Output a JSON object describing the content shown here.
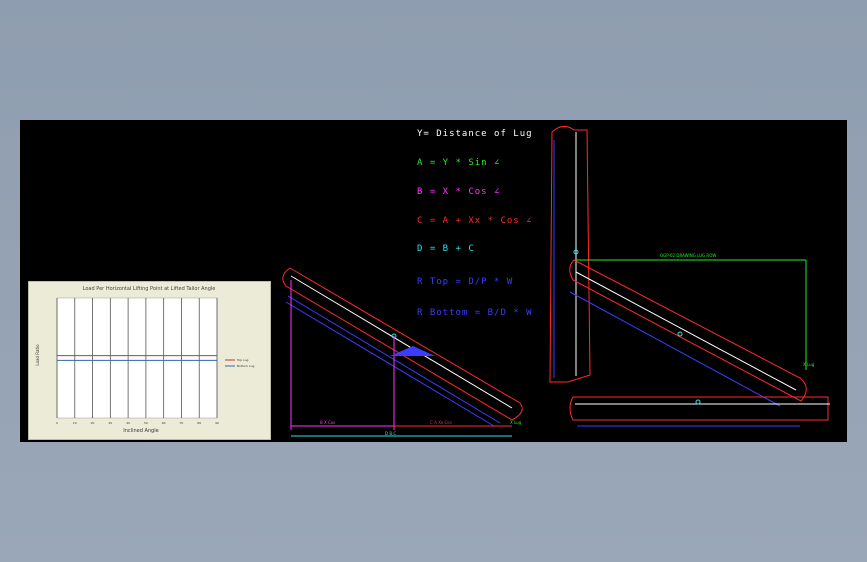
{
  "formulas": {
    "y_def": "Y= Distance of Lug",
    "a": "A = Y * Sin ∠",
    "b": "B = X * Cos ∠",
    "c": "C = A + Xx * Cos ∠",
    "d": "D = B + C",
    "r_top": "R Top = D/P * W",
    "r_bottom": "R Bottom = B/D * W"
  },
  "colors": {
    "white": "#ffffff",
    "green": "#22ee22",
    "magenta": "#ff33ff",
    "red": "#ff2a2a",
    "cyan": "#33e0e0",
    "blue": "#3c3cff",
    "panel": "#ecebd8"
  },
  "dimensions": {
    "left_b": "B X Cos",
    "left_c": "C A Xx Cos",
    "left_d": "D B C",
    "left_lug": "X Lug",
    "right_top": "OGP-02 DRAWING LUG ROW",
    "right_small": "X Lug"
  },
  "chart_data": {
    "type": "line",
    "title": "Load Per Horizontal Lifting Point at Lifted Tailor Angle",
    "xlabel": "Inclined Angle",
    "ylabel": "Load Ratio",
    "x": [
      0,
      10,
      20,
      30,
      40,
      50,
      60,
      70,
      80,
      90
    ],
    "ylim": [
      0,
      100
    ],
    "series": [
      {
        "name": "Top Lug",
        "values": [
          52,
          52,
          52,
          52,
          52,
          52,
          52,
          52,
          52,
          52
        ],
        "color": "#cc3333"
      },
      {
        "name": "Bottom Lug",
        "values": [
          48,
          48,
          48,
          48,
          48,
          48,
          48,
          48,
          48,
          48
        ],
        "color": "#3366aa"
      }
    ],
    "legend": "right",
    "grid": true
  }
}
